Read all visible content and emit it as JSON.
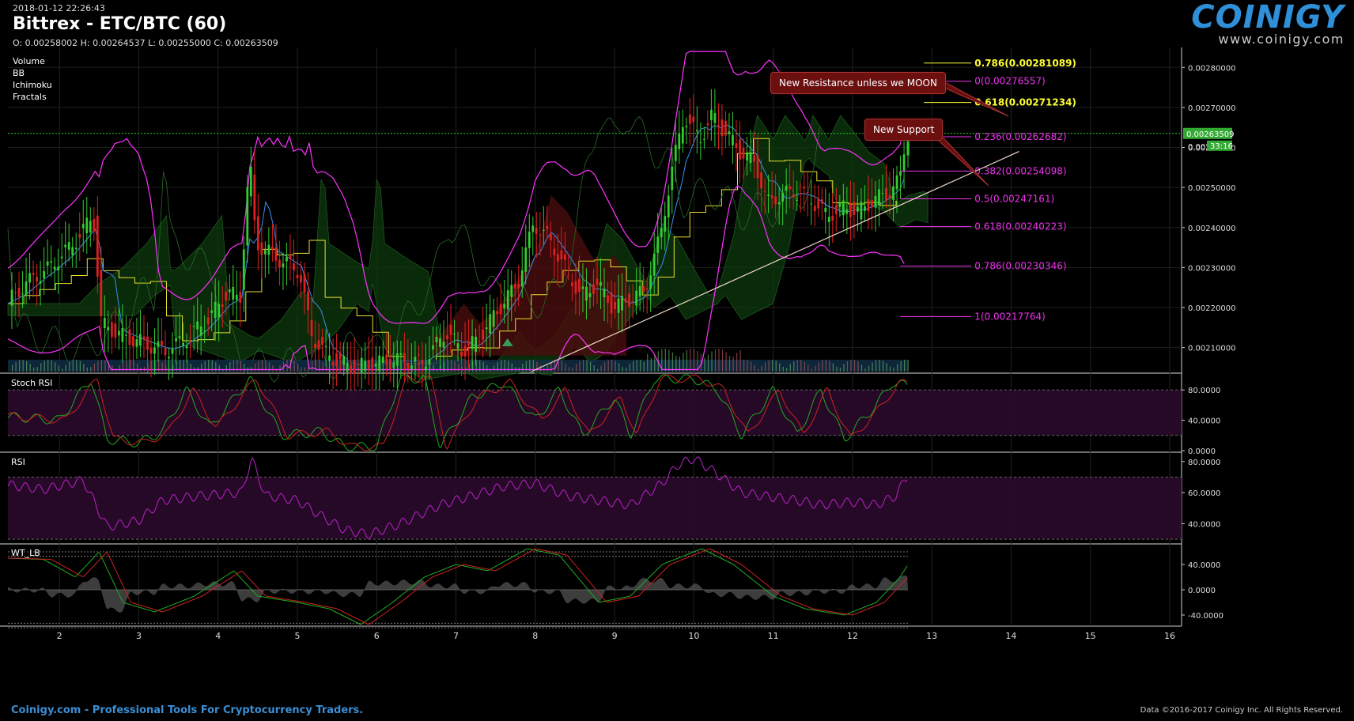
{
  "header": {
    "timestamp": "2018-01-12 22:26:43",
    "title": "Bittrex - ETC/BTC (60)",
    "ohlc": "O: 0.00258002 H: 0.00264537 L: 0.00255000 C: 0.00263509"
  },
  "logo": {
    "name": "COINIGY",
    "url": "www.coinigy.com"
  },
  "indicators": [
    "Volume",
    "BB",
    "Ichimoku",
    "Fractals"
  ],
  "footer": {
    "left": "Coinigy.com - Professional Tools For Cryptocurrency Traders.",
    "right": "Data ©2016-2017 Coinigy Inc. All Rights Reserved."
  },
  "annotations": {
    "resistance": "New Resistance unless we MOON",
    "support": "New Support"
  },
  "colors": {
    "background": "#000000",
    "up_candle": "#33cc33",
    "down_candle": "#e02020",
    "bollinger": "#ff33ff",
    "fib_yellow": "#ffff33",
    "fib_magenta": "#ee33ee",
    "trendline": "#f0d8c8",
    "price_badge": "#33aa33",
    "stoch_k": "#22aa22",
    "stoch_d": "#cc2222",
    "rsi": "#bb22cc",
    "logo": "#2f8fd8"
  },
  "chart_data": [
    {
      "type": "candlestick",
      "pane": "price",
      "x_tick_labels": [
        "2",
        "3",
        "4",
        "5",
        "6",
        "7",
        "8",
        "9",
        "10",
        "11",
        "12",
        "13",
        "14",
        "15",
        "16"
      ],
      "x_ticks": [
        2,
        3,
        4,
        5,
        6,
        7,
        8,
        9,
        10,
        11,
        12,
        13,
        14,
        15,
        16
      ],
      "xlim": [
        1.35,
        16.15
      ],
      "ylim": [
        0.00204,
        0.00285
      ],
      "y_tick_labels": [
        "0.00280000",
        "0.00270000",
        "0.00260000",
        "0.00250000",
        "0.00240000",
        "0.00230000",
        "0.00220000",
        "0.00210000"
      ],
      "y_ticks": [
        0.0028,
        0.0027,
        0.0026,
        0.0025,
        0.0024,
        0.0023,
        0.0022,
        0.0021
      ],
      "last_price": {
        "label": "0.00263509",
        "value": 0.00263509
      },
      "timer": {
        "label": "33:16",
        "price_label": "0.002"
      },
      "price_path": [
        [
          1.35,
          0.00221
        ],
        [
          1.6,
          0.00226
        ],
        [
          1.9,
          0.0023
        ],
        [
          2.2,
          0.00236
        ],
        [
          2.45,
          0.00243
        ],
        [
          2.55,
          0.00216
        ],
        [
          2.8,
          0.00213
        ],
        [
          3.1,
          0.00211
        ],
        [
          3.35,
          0.00209
        ],
        [
          3.6,
          0.00212
        ],
        [
          3.9,
          0.00217
        ],
        [
          4.15,
          0.00224
        ],
        [
          4.3,
          0.00222
        ],
        [
          4.42,
          0.00258
        ],
        [
          4.5,
          0.00236
        ],
        [
          4.8,
          0.00232
        ],
        [
          5.05,
          0.00229
        ],
        [
          5.2,
          0.00213
        ],
        [
          5.4,
          0.00208
        ],
        [
          5.7,
          0.00205
        ],
        [
          6.0,
          0.00206
        ],
        [
          6.3,
          0.00207
        ],
        [
          6.6,
          0.00206
        ],
        [
          6.9,
          0.00214
        ],
        [
          7.1,
          0.00209
        ],
        [
          7.3,
          0.00212
        ],
        [
          7.5,
          0.00218
        ],
        [
          7.8,
          0.00226
        ],
        [
          8.0,
          0.00241
        ],
        [
          8.2,
          0.00237
        ],
        [
          8.45,
          0.00228
        ],
        [
          8.6,
          0.00223
        ],
        [
          8.8,
          0.00226
        ],
        [
          9.0,
          0.0022
        ],
        [
          9.2,
          0.00222
        ],
        [
          9.4,
          0.00224
        ],
        [
          9.6,
          0.00238
        ],
        [
          9.75,
          0.00255
        ],
        [
          9.9,
          0.00268
        ],
        [
          10.1,
          0.00262
        ],
        [
          10.25,
          0.00268
        ],
        [
          10.45,
          0.00263
        ],
        [
          10.6,
          0.00259
        ],
        [
          10.8,
          0.00256
        ],
        [
          10.95,
          0.00246
        ],
        [
          11.1,
          0.00248
        ],
        [
          11.3,
          0.00249
        ],
        [
          11.5,
          0.00247
        ],
        [
          11.7,
          0.00243
        ],
        [
          11.9,
          0.00245
        ],
        [
          12.1,
          0.00244
        ],
        [
          12.3,
          0.00247
        ],
        [
          12.5,
          0.00249
        ],
        [
          12.62,
          0.00252
        ],
        [
          12.7,
          0.002635
        ]
      ],
      "fibonacci": [
        {
          "label": "0.786(0.00281089)",
          "value": 0.00281089,
          "color": "yellow"
        },
        {
          "label": "0(0.00276557)",
          "value": 0.00276557,
          "color": "magenta"
        },
        {
          "label": "0.618(0.00271234)",
          "value": 0.00271234,
          "color": "yellow"
        },
        {
          "label": "0.236(0.00262682)",
          "value": 0.00262682,
          "color": "magenta"
        },
        {
          "label": "0.382(0.00254098)",
          "value": 0.00254098,
          "color": "magenta"
        },
        {
          "label": "0.5(0.00247161)",
          "value": 0.00247161,
          "color": "magenta"
        },
        {
          "label": "0.618(0.00240223)",
          "value": 0.00240223,
          "color": "magenta"
        },
        {
          "label": "0.786(0.00230346)",
          "value": 0.00230346,
          "color": "magenta"
        },
        {
          "label": "1(0.00217764)",
          "value": 0.00217764,
          "color": "magenta"
        }
      ],
      "trendline": [
        [
          7.95,
          0.00204
        ],
        [
          14.1,
          0.00259
        ]
      ]
    },
    {
      "type": "line",
      "pane": "Stoch RSI",
      "ylim": [
        0,
        100
      ],
      "y_tick_labels": [
        "80.0000",
        "40.0000",
        "0.0000"
      ],
      "y_ticks": [
        80,
        40,
        0
      ],
      "band": [
        20,
        80
      ],
      "k_path": [
        [
          1.35,
          45
        ],
        [
          2.0,
          40
        ],
        [
          2.4,
          95
        ],
        [
          2.6,
          15
        ],
        [
          3.0,
          10
        ],
        [
          3.3,
          25
        ],
        [
          3.6,
          80
        ],
        [
          3.9,
          30
        ],
        [
          4.4,
          95
        ],
        [
          4.8,
          20
        ],
        [
          5.3,
          25
        ],
        [
          5.6,
          5
        ],
        [
          6.0,
          5
        ],
        [
          6.3,
          95
        ],
        [
          6.6,
          95
        ],
        [
          6.8,
          5
        ],
        [
          7.2,
          70
        ],
        [
          7.6,
          90
        ],
        [
          8.0,
          40
        ],
        [
          8.3,
          80
        ],
        [
          8.6,
          20
        ],
        [
          9.0,
          70
        ],
        [
          9.2,
          20
        ],
        [
          9.5,
          95
        ],
        [
          10.0,
          95
        ],
        [
          10.3,
          80
        ],
        [
          10.6,
          20
        ],
        [
          11.0,
          80
        ],
        [
          11.3,
          20
        ],
        [
          11.6,
          80
        ],
        [
          11.9,
          15
        ],
        [
          12.3,
          60
        ],
        [
          12.5,
          90
        ],
        [
          12.7,
          85
        ]
      ]
    },
    {
      "type": "line",
      "pane": "RSI",
      "ylim": [
        28,
        85
      ],
      "y_tick_labels": [
        "80.0000",
        "60.0000",
        "40.0000"
      ],
      "y_ticks": [
        80,
        60,
        40
      ],
      "band": [
        30,
        70
      ],
      "path": [
        [
          1.35,
          65
        ],
        [
          1.8,
          62
        ],
        [
          2.3,
          68
        ],
        [
          2.6,
          38
        ],
        [
          3.0,
          42
        ],
        [
          3.3,
          55
        ],
        [
          3.8,
          58
        ],
        [
          4.3,
          60
        ],
        [
          4.42,
          82
        ],
        [
          4.6,
          58
        ],
        [
          5.0,
          55
        ],
        [
          5.3,
          45
        ],
        [
          5.6,
          36
        ],
        [
          5.9,
          33
        ],
        [
          6.3,
          40
        ],
        [
          6.8,
          52
        ],
        [
          7.2,
          58
        ],
        [
          7.6,
          64
        ],
        [
          8.0,
          66
        ],
        [
          8.4,
          58
        ],
        [
          8.8,
          55
        ],
        [
          9.2,
          52
        ],
        [
          9.6,
          66
        ],
        [
          9.8,
          78
        ],
        [
          10.0,
          82
        ],
        [
          10.3,
          72
        ],
        [
          10.6,
          60
        ],
        [
          11.0,
          57
        ],
        [
          11.3,
          55
        ],
        [
          11.6,
          52
        ],
        [
          12.0,
          54
        ],
        [
          12.3,
          52
        ],
        [
          12.55,
          58
        ],
        [
          12.7,
          72
        ]
      ]
    },
    {
      "type": "line",
      "pane": "WT_LB",
      "ylim": [
        -55,
        70
      ],
      "y_tick_labels": [
        "40.0000",
        "0.0000",
        "-40.0000"
      ],
      "y_ticks": [
        40,
        0,
        -40
      ],
      "levels": [
        60,
        53,
        -53,
        -60
      ],
      "wt1_path": [
        [
          1.35,
          50
        ],
        [
          1.8,
          48
        ],
        [
          2.2,
          20
        ],
        [
          2.5,
          60
        ],
        [
          2.8,
          -20
        ],
        [
          3.2,
          -35
        ],
        [
          3.7,
          -10
        ],
        [
          4.2,
          30
        ],
        [
          4.5,
          -10
        ],
        [
          5.0,
          -20
        ],
        [
          5.4,
          -30
        ],
        [
          5.8,
          -55
        ],
        [
          6.2,
          -20
        ],
        [
          6.6,
          20
        ],
        [
          7.0,
          40
        ],
        [
          7.4,
          30
        ],
        [
          7.9,
          65
        ],
        [
          8.3,
          55
        ],
        [
          8.8,
          -20
        ],
        [
          9.2,
          -10
        ],
        [
          9.6,
          40
        ],
        [
          10.1,
          65
        ],
        [
          10.5,
          40
        ],
        [
          11.0,
          -10
        ],
        [
          11.4,
          -30
        ],
        [
          11.9,
          -40
        ],
        [
          12.3,
          -20
        ],
        [
          12.6,
          20
        ],
        [
          12.7,
          40
        ]
      ]
    }
  ]
}
